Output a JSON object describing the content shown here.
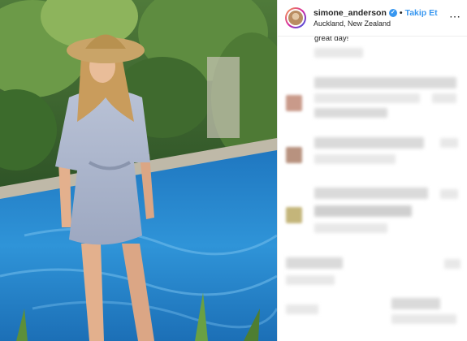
{
  "post": {
    "username": "simone_anderson",
    "follow_label": "Takip Et",
    "separator": "•",
    "location": "Auckland, New Zealand",
    "more_icon": "⋯",
    "verified_icon": "✓"
  },
  "comments": {
    "visible_fragment": "great day!"
  },
  "colors": {
    "link_blue": "#3897f0",
    "text": "#262626",
    "pool": "#2f86c9"
  }
}
